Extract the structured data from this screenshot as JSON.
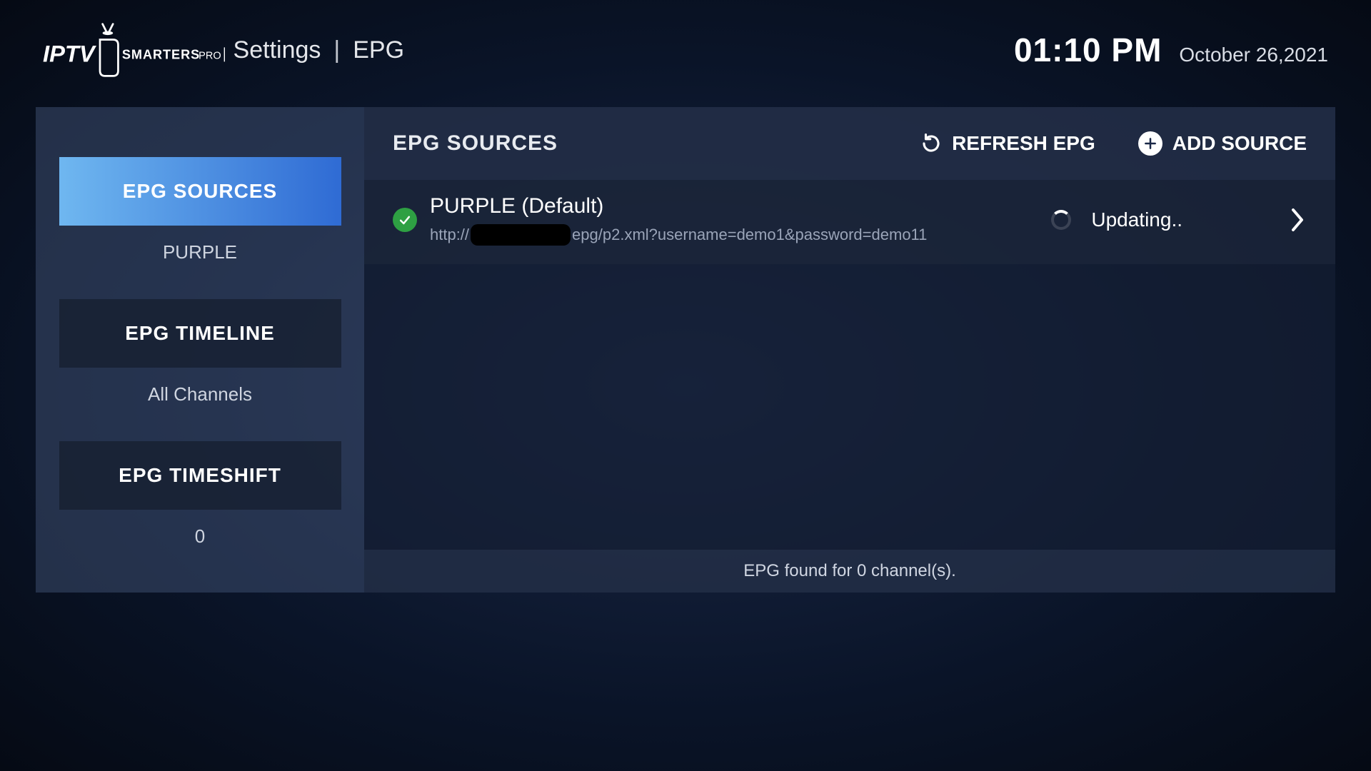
{
  "header": {
    "breadcrumb": {
      "item1": "Settings",
      "item2": "EPG"
    },
    "time": "01:10 PM",
    "date": "October 26,2021"
  },
  "sidebar": {
    "items": [
      {
        "label": "EPG SOURCES",
        "sub": "PURPLE"
      },
      {
        "label": "EPG TIMELINE",
        "sub": "All Channels"
      },
      {
        "label": "EPG TIMESHIFT",
        "sub": "0"
      }
    ]
  },
  "content": {
    "title": "EPG SOURCES",
    "actions": {
      "refresh": "REFRESH EPG",
      "add": "ADD SOURCE"
    },
    "source": {
      "name": "PURPLE (Default)",
      "url_prefix": "http://",
      "url_suffix": "epg/p2.xml?username=demo1&password=demo11",
      "status": "Updating.."
    },
    "footer": "EPG found for 0 channel(s)."
  }
}
